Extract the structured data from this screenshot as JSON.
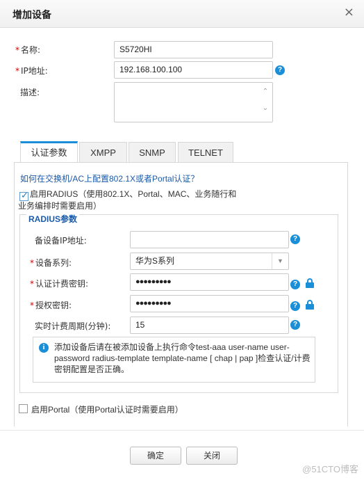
{
  "dialog": {
    "title": "增加设备",
    "close_icon": "×"
  },
  "form": {
    "name_label": "名称:",
    "name_value": "S5720HI",
    "ip_label": "IP地址:",
    "ip_value": "192.168.100.100",
    "desc_label": "描述:",
    "desc_value": "",
    "required_mark": "*"
  },
  "tabs": [
    {
      "label": "认证参数",
      "active": true
    },
    {
      "label": "XMPP",
      "active": false
    },
    {
      "label": "SNMP",
      "active": false
    },
    {
      "label": "TELNET",
      "active": false
    }
  ],
  "auth": {
    "help_link": "如何在交换机/AC上配置802.1X或者Portal认证？",
    "radius_checkbox_label": "启用RADIUS（使用802.1X、Portal、MAC、业务随行和业务编排时需要启用）",
    "radius_checked": true,
    "radius_legend": "RADIUS参数",
    "backup_ip_label": "备设备IP地址:",
    "backup_ip_value": "",
    "series_label": "设备系列:",
    "series_value": "华为S系列",
    "acct_key_label": "认证计费密钥:",
    "acct_key_value": "●●●●●●●●●",
    "authz_key_label": "授权密钥:",
    "authz_key_value": "●●●●●●●●●",
    "period_label": "实时计费周期(分钟):",
    "period_value": "15",
    "info_text": "添加设备后请在被添加设备上执行命令test-aaa user-name user-password radius-template template-name [ chap | pap ]检查认证/计费密钥配置是否正确。",
    "portal_checkbox_label": "启用Portal（使用Portal认证时需要启用）",
    "portal_checked": false
  },
  "buttons": {
    "ok": "确定",
    "close": "关闭"
  },
  "icons": {
    "help": "?",
    "info": "i",
    "dropdown": "▼",
    "scroll_up": "⌃",
    "scroll_down": "⌄"
  },
  "colors": {
    "accent": "#1a8fd8",
    "required": "#d40000",
    "link": "#1a5aa8"
  },
  "watermark": "@51CTO博客"
}
